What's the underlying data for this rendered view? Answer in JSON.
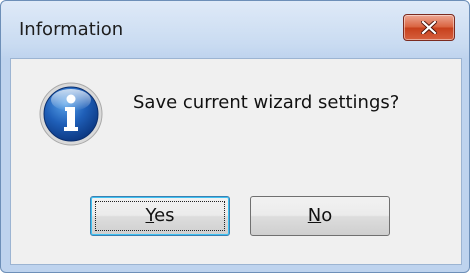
{
  "window": {
    "title": "Information",
    "close_icon": "close-x-icon",
    "close_button_color": "#c7401c"
  },
  "dialog": {
    "icon": "info-icon",
    "message": "Save current wizard settings?"
  },
  "buttons": {
    "yes": {
      "mnemonic": "Y",
      "rest": "es"
    },
    "no": {
      "mnemonic": "N",
      "rest": "o"
    }
  }
}
